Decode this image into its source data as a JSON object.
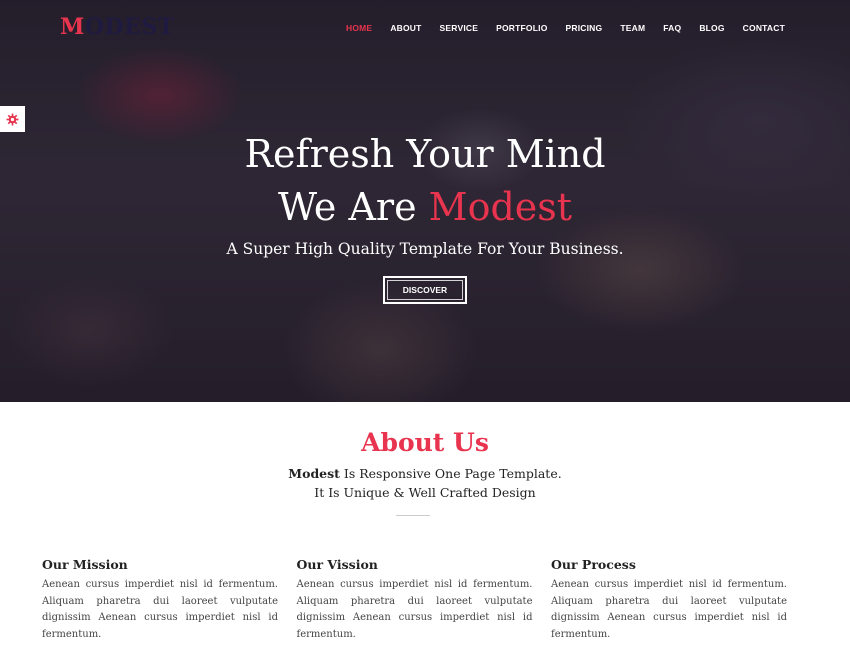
{
  "brand": {
    "first_letter": "M",
    "rest": "ODEST",
    "accent_color": "#e8344e",
    "dark_color": "#1f1a40"
  },
  "nav": {
    "items": [
      {
        "label": "HOME",
        "active": true
      },
      {
        "label": "ABOUT"
      },
      {
        "label": "SERVICE"
      },
      {
        "label": "PORTFOLIO"
      },
      {
        "label": "PRICING"
      },
      {
        "label": "TEAM"
      },
      {
        "label": "FAQ"
      },
      {
        "label": "BLOG"
      },
      {
        "label": "CONTACT"
      }
    ]
  },
  "settings": {
    "icon": "gear-icon"
  },
  "hero": {
    "title_line1": "Refresh Your Mind",
    "title_line2_prefix": "We Are ",
    "title_line2_accent": "Modest",
    "subtitle": "A Super High Quality Template For Your Business.",
    "button_label": "DISCOVER"
  },
  "about": {
    "title": "About Us",
    "line1_bold": "Modest",
    "line1_rest": " Is Responsive One Page Template.",
    "line2": "It Is Unique & Well Crafted Design",
    "columns": [
      {
        "heading": "Our Mission",
        "text": "Aenean cursus imperdiet nisl id fermentum. Aliquam pharetra dui laoreet vulputate dignissim Aenean cursus imperdiet nisl id fermentum."
      },
      {
        "heading": "Our Vission",
        "text": "Aenean cursus imperdiet nisl id fermentum. Aliquam pharetra dui laoreet vulputate dignissim Aenean cursus imperdiet nisl id fermentum."
      },
      {
        "heading": "Our Process",
        "text": "Aenean cursus imperdiet nisl id fermentum. Aliquam pharetra dui laoreet vulputate dignissim Aenean cursus imperdiet nisl id fermentum."
      }
    ]
  }
}
